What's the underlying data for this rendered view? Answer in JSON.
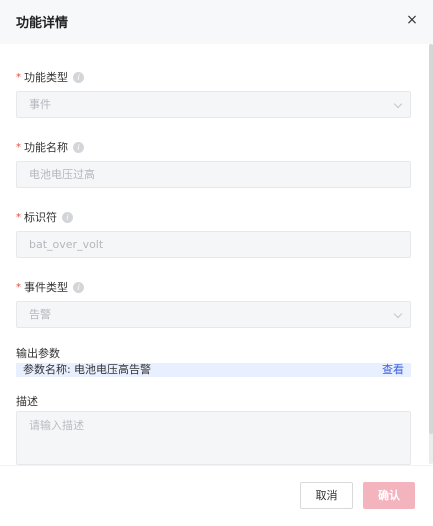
{
  "dialog": {
    "title": "功能详情",
    "close_glyph": "×"
  },
  "fields": {
    "function_type": {
      "label": "功能类型",
      "value": "事件"
    },
    "function_name": {
      "label": "功能名称",
      "value": "电池电压过高"
    },
    "identifier": {
      "label": "标识符",
      "value": "bat_over_volt"
    },
    "event_type": {
      "label": "事件类型",
      "value": "告警"
    }
  },
  "output": {
    "label": "输出参数",
    "param_key": "参数名称:",
    "param_value": "电池电压高告警",
    "view_link": "查看"
  },
  "description": {
    "label": "描述",
    "placeholder": "请输入描述"
  },
  "buttons": {
    "cancel": "取消",
    "confirm": "确认"
  },
  "required_mark": "*",
  "info_glyph": "i",
  "colors": {
    "accent_link": "#3c63e0",
    "confirm_disabled": "#f3b4bd",
    "required": "#e74c3c"
  }
}
